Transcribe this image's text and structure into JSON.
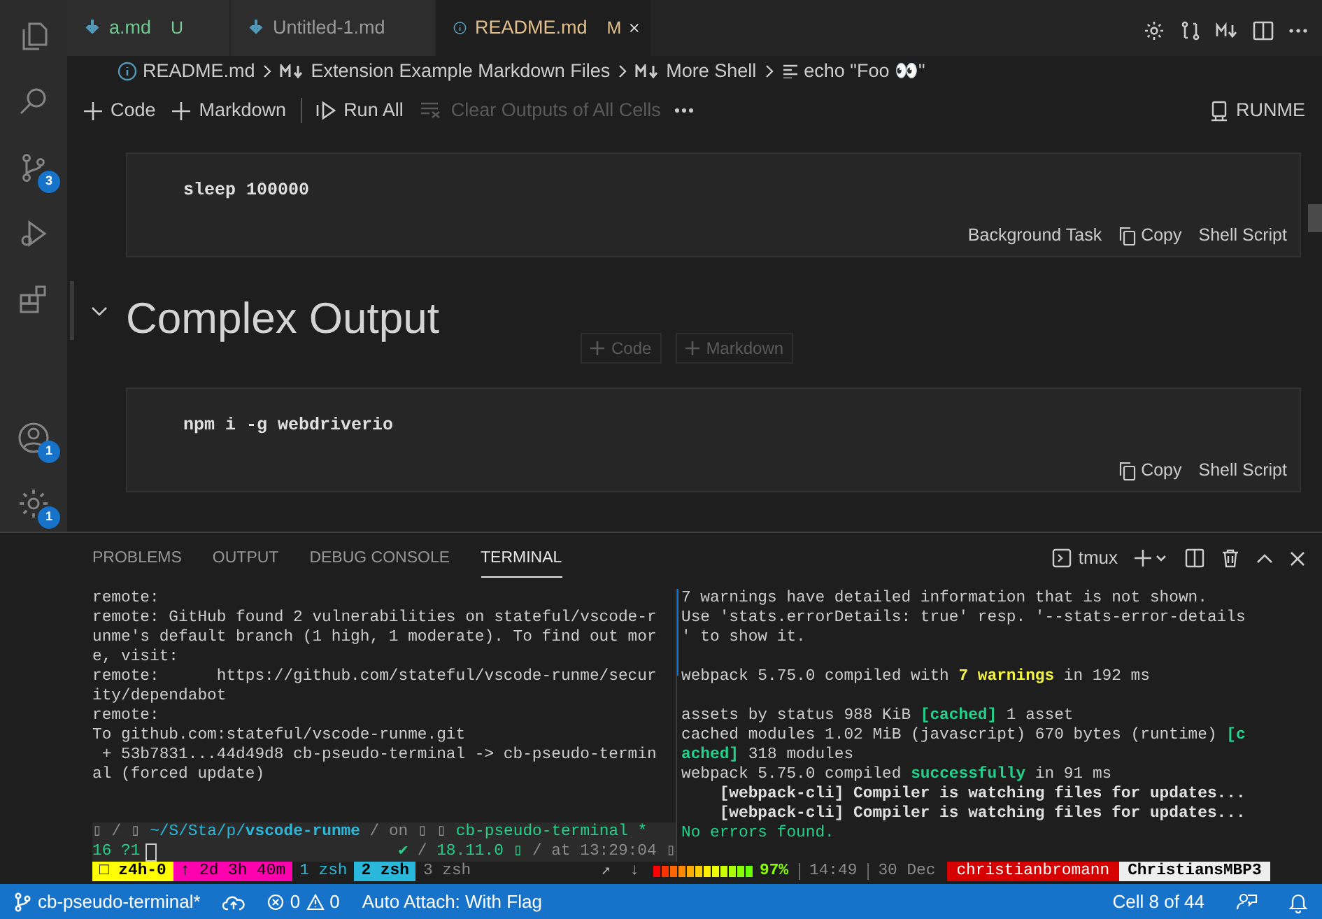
{
  "activity_badges": {
    "source_control": "3",
    "accounts": "1",
    "settings": "1"
  },
  "tabs": [
    {
      "label": "a.md",
      "badge": "U",
      "selected": false
    },
    {
      "label": "Untitled-1.md",
      "selected": false
    },
    {
      "label": "README.md",
      "badge": "M",
      "selected": true
    }
  ],
  "breadcrumbs": [
    "README.md",
    "Extension Example Markdown Files",
    "More Shell",
    "echo \"Foo 👀\""
  ],
  "toolbar": [
    {
      "label": "Code",
      "disabled": false
    },
    {
      "label": "Markdown",
      "disabled": false
    },
    {
      "label": "Run All",
      "disabled": false
    },
    {
      "label": "Clear Outputs of All Cells",
      "disabled": true
    }
  ],
  "runme": "RUNME",
  "cells": [
    {
      "kind": "code",
      "code": "sleep 100000",
      "actions": [
        {
          "kind": "text",
          "label": "Background Task"
        },
        {
          "kind": "copy",
          "label": "Copy"
        },
        {
          "kind": "text",
          "label": "Shell Script"
        }
      ]
    },
    {
      "kind": "heading",
      "text": "Complex Output",
      "expanded": true,
      "insert": [
        "Code",
        "Markdown"
      ]
    },
    {
      "kind": "code",
      "code": "npm i -g webdriverio",
      "actions": [
        {
          "kind": "copy",
          "label": "Copy"
        },
        {
          "kind": "text",
          "label": "Shell Script"
        }
      ]
    }
  ],
  "panel_tabs": [
    {
      "label": "PROBLEMS",
      "selected": false
    },
    {
      "label": "OUTPUT",
      "selected": false
    },
    {
      "label": "DEBUG CONSOLE",
      "selected": false
    },
    {
      "label": "TERMINAL",
      "selected": true
    }
  ],
  "terminal_name": "tmux",
  "left_pane": [
    [
      {
        "kind": "plain",
        "text": "remote:"
      }
    ],
    [
      {
        "kind": "plain",
        "text": "remote: GitHub found 2 vulnerabilities on stateful/vscode-r"
      }
    ],
    [
      {
        "kind": "plain",
        "text": "unme's default branch (1 high, 1 moderate). To find out mor"
      }
    ],
    [
      {
        "kind": "plain",
        "text": "e, visit:"
      }
    ],
    [
      {
        "kind": "plain",
        "text": "remote:      https://github.com/stateful/vscode-runme/secur"
      }
    ],
    [
      {
        "kind": "plain",
        "text": "ity/dependabot"
      }
    ],
    [
      {
        "kind": "plain",
        "text": "remote:"
      }
    ],
    [
      {
        "kind": "plain",
        "text": "To github.com:stateful/vscode-runme.git"
      }
    ],
    [
      {
        "kind": "plain",
        "text": " + 53b7831...44d49d8 cb-pseudo-terminal -> cb-pseudo-termin"
      }
    ],
    [
      {
        "kind": "plain",
        "text": "al (forced update)"
      }
    ]
  ],
  "prompt": {
    "line1": [
      {
        "kind": "gray",
        "text": "▯ / ▯ "
      },
      {
        "kind": "blue",
        "text": "~/S/Sta/p/"
      },
      {
        "kind": "blue-bold",
        "text": "vscode-runme"
      },
      {
        "kind": "gray",
        "text": " / on ▯ ▯ "
      },
      {
        "kind": "green",
        "text": "cb-pseudo-terminal *"
      }
    ],
    "line2_left": [
      {
        "kind": "green",
        "text": "16 ?1"
      }
    ],
    "line2_right": [
      {
        "kind": "green",
        "text": "✔"
      },
      {
        "kind": "gray",
        "text": " / "
      },
      {
        "kind": "green",
        "text": "18.11.0 ▯"
      },
      {
        "kind": "gray",
        "text": " / at 13:29:04 ▯"
      }
    ]
  },
  "right_pane": [
    {
      "gap": false,
      "segments": [
        {
          "kind": "plain",
          "text": "7 warnings have detailed information that is not shown."
        }
      ]
    },
    {
      "gap": false,
      "segments": [
        {
          "kind": "plain",
          "text": "Use 'stats.errorDetails: true' resp. '--stats-error-details"
        }
      ]
    },
    {
      "gap": false,
      "segments": [
        {
          "kind": "plain",
          "text": "' to show it."
        }
      ]
    },
    {
      "gap": true,
      "segments": [
        {
          "kind": "plain",
          "text": "webpack 5.75.0 compiled with "
        },
        {
          "kind": "yellow-bold",
          "text": "7 warnings"
        },
        {
          "kind": "plain",
          "text": " in 192 ms"
        }
      ]
    },
    {
      "gap": true,
      "segments": [
        {
          "kind": "plain",
          "text": "assets by status 988 KiB "
        },
        {
          "kind": "green-bold",
          "text": "[cached]"
        },
        {
          "kind": "plain",
          "text": " 1 asset"
        }
      ]
    },
    {
      "gap": false,
      "segments": [
        {
          "kind": "plain",
          "text": "cached modules 1.02 MiB (javascript) 670 bytes (runtime) "
        },
        {
          "kind": "green-bold",
          "text": "[c"
        }
      ]
    },
    {
      "gap": false,
      "segments": [
        {
          "kind": "green-bold",
          "text": "ached]"
        },
        {
          "kind": "plain",
          "text": " 318 modules"
        }
      ]
    },
    {
      "gap": false,
      "segments": [
        {
          "kind": "plain",
          "text": "webpack 5.75.0 compiled "
        },
        {
          "kind": "green-bold",
          "text": "successfully"
        },
        {
          "kind": "plain",
          "text": " in 91 ms"
        }
      ]
    },
    {
      "gap": false,
      "segments": [
        {
          "kind": "bold",
          "text": "    [webpack-cli] Compiler is watching files for updates..."
        }
      ]
    },
    {
      "gap": false,
      "segments": [
        {
          "kind": "bold",
          "text": "    [webpack-cli] Compiler is watching files for updates..."
        }
      ]
    },
    {
      "gap": false,
      "segments": [
        {
          "kind": "green",
          "text": "No errors found."
        }
      ]
    }
  ],
  "tmux_left": [
    {
      "kind": "session",
      "text": "□ z4h-0"
    },
    {
      "kind": "uptime",
      "text": "↑ 2d 3h 40m"
    },
    {
      "kind": "window",
      "text": "1 zsh",
      "selected": false
    },
    {
      "kind": "window",
      "text": "2 zsh",
      "selected": true
    },
    {
      "kind": "window-idle",
      "text": "3 zsh",
      "selected": false
    }
  ],
  "tmux_right": {
    "arrows": "↗  ↓",
    "battery": {
      "level": 0.97,
      "reading": "97%"
    },
    "time": "14:49",
    "date": "30 Dec",
    "user": "christianbromann",
    "host": "ChristiansMBP3"
  },
  "status_bar": {
    "branch": "cb-pseudo-terminal*",
    "errors": "0",
    "warnings": "0",
    "auto_attach": "Auto Attach: With Flag",
    "cell": "Cell 8 of 44"
  }
}
